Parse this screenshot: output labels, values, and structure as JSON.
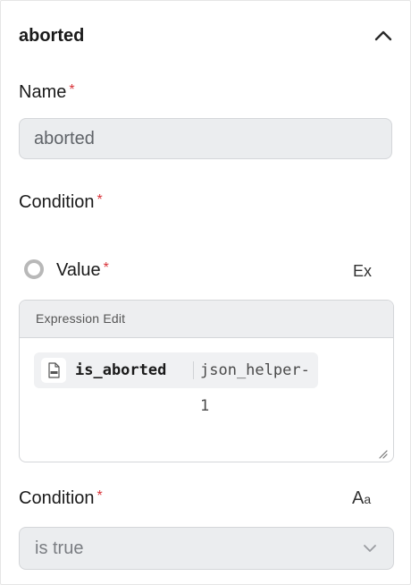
{
  "section": {
    "title": "aborted"
  },
  "name_field": {
    "label": "Name",
    "required_mark": "*",
    "value": "aborted"
  },
  "condition_section": {
    "label": "Condition",
    "required_mark": "*"
  },
  "value_row": {
    "label": "Value",
    "required_mark": "*",
    "mode_toggle": "Ex",
    "selected": false
  },
  "expression_editor": {
    "header": "Expression Edit",
    "token": {
      "name": "is_aborted",
      "source": "json_helper-1",
      "icon": "json-file-icon"
    }
  },
  "condition_select": {
    "label": "Condition",
    "required_mark": "*",
    "mode_toggle_big": "A",
    "mode_toggle_small": "a",
    "value": "is true"
  },
  "colors": {
    "required": "#d9343a",
    "input_bg": "#ebedef",
    "border": "#d4d6d9"
  }
}
